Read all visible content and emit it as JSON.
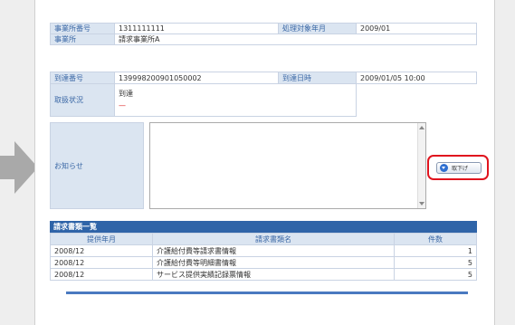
{
  "header": {
    "office_no_label": "事業所番号",
    "office_no": "1311111111",
    "period_label": "処理対象年月",
    "period": "2009/01",
    "office_label": "事業所",
    "office": "請求事業所A"
  },
  "arrival": {
    "no_label": "到達番号",
    "no": "1399982009010500​02",
    "datetime_label": "到達日時",
    "datetime": "2009/01/05 10:00",
    "status_label": "取扱状況",
    "status": "到達",
    "status_sub": "—"
  },
  "notice": {
    "label": "お知らせ",
    "download_label": "取下げ"
  },
  "invoice_list": {
    "title": "請求書類一覧",
    "columns": [
      "提供年月",
      "請求書類名",
      "件数"
    ],
    "rows": [
      [
        "2008/12",
        "介護給付費等請求書情報",
        "1"
      ],
      [
        "2008/12",
        "介護給付費等明細書情報",
        "5"
      ],
      [
        "2008/12",
        "サービス提供実績記録票情報",
        "5"
      ]
    ]
  },
  "colors": {
    "accent": "#2f64a8",
    "label_bg": "#dbe5f1",
    "highlight": "#e0141e"
  }
}
